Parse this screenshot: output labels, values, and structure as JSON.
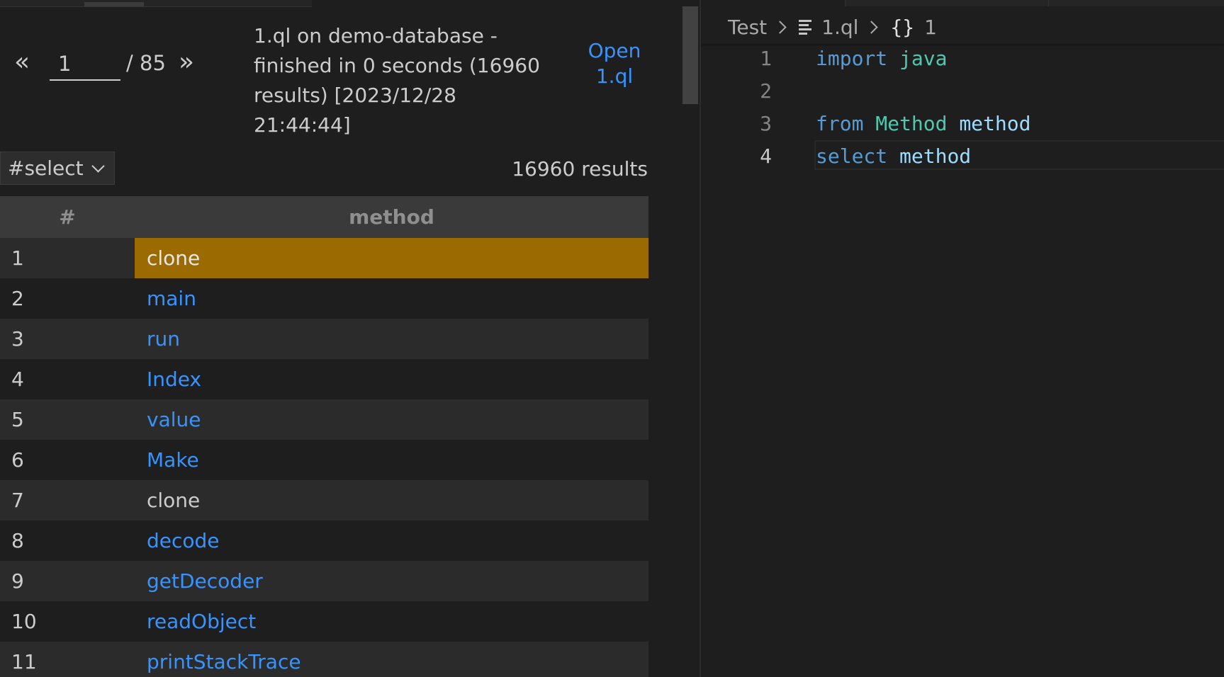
{
  "results": {
    "pager": {
      "prev_label": "«",
      "next_label": "»",
      "current_page": "1",
      "total_pages": "/ 85"
    },
    "status_text": "1.ql on demo-database - finished in 0 seconds (16960 results) [2023/12/28 21:44:44]",
    "open_query_label": "Open 1.ql",
    "result_set": "#select",
    "result_count": "16960 results",
    "table": {
      "headers": [
        "#",
        "method"
      ],
      "rows": [
        {
          "n": "1",
          "method": "clone"
        },
        {
          "n": "2",
          "method": "main"
        },
        {
          "n": "3",
          "method": "run"
        },
        {
          "n": "4",
          "method": "Index"
        },
        {
          "n": "5",
          "method": "value"
        },
        {
          "n": "6",
          "method": "Make"
        },
        {
          "n": "7",
          "method": "clone"
        },
        {
          "n": "8",
          "method": "decode"
        },
        {
          "n": "9",
          "method": "getDecoder"
        },
        {
          "n": "10",
          "method": "readObject"
        },
        {
          "n": "11",
          "method": "printStackTrace"
        }
      ]
    }
  },
  "editor": {
    "breadcrumb": {
      "folder": "Test",
      "file": "1.ql",
      "symbol": "1"
    },
    "lines": [
      {
        "num": "1",
        "tokens": [
          {
            "t": "import",
            "c": "kw"
          },
          {
            "t": " ",
            "c": ""
          },
          {
            "t": "java",
            "c": "ty"
          }
        ]
      },
      {
        "num": "2",
        "tokens": []
      },
      {
        "num": "3",
        "tokens": [
          {
            "t": "from",
            "c": "kw"
          },
          {
            "t": " ",
            "c": ""
          },
          {
            "t": "Method",
            "c": "ty"
          },
          {
            "t": " ",
            "c": ""
          },
          {
            "t": "method",
            "c": "var"
          }
        ]
      },
      {
        "num": "4",
        "tokens": [
          {
            "t": "select",
            "c": "kw"
          },
          {
            "t": " ",
            "c": ""
          },
          {
            "t": "method",
            "c": "var"
          }
        ]
      }
    ],
    "active_line": "4"
  },
  "colors": {
    "background": "#1e1e1e",
    "link": "#3794ff",
    "selected_cell": "#9b6a00",
    "keyword": "#569cd6",
    "type": "#4ec9b0",
    "variable": "#9cdcfe"
  }
}
